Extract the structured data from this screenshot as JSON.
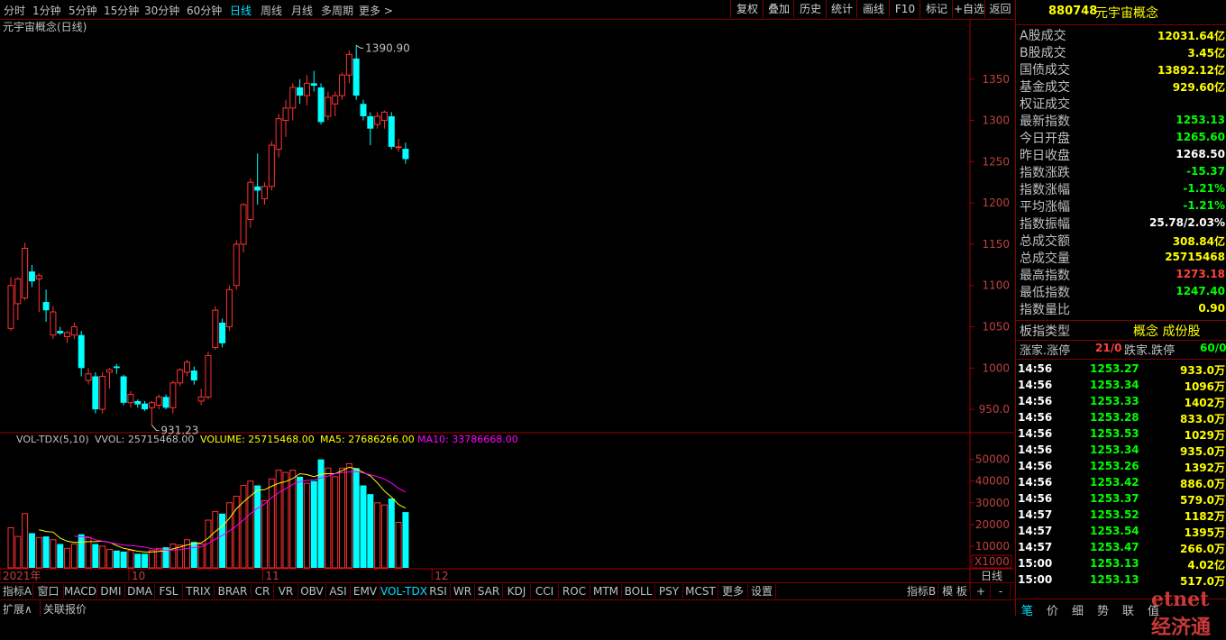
{
  "period_tabs": [
    {
      "label": "分时"
    },
    {
      "label": "1分钟"
    },
    {
      "label": "5分钟"
    },
    {
      "label": "15分钟"
    },
    {
      "label": "30分钟"
    },
    {
      "label": "60分钟"
    },
    {
      "label": "日线"
    },
    {
      "label": "周线"
    },
    {
      "label": "月线"
    },
    {
      "label": "多周期"
    },
    {
      "label": "更多 >"
    }
  ],
  "active_period": "日线",
  "tool_buttons": [
    {
      "label": "复权"
    },
    {
      "label": "叠加"
    },
    {
      "label": "历史"
    },
    {
      "label": "统计"
    },
    {
      "label": "画线"
    },
    {
      "label": "F10"
    },
    {
      "label": "标记"
    },
    {
      "label": "+自选"
    },
    {
      "label": "返回"
    }
  ],
  "chart": {
    "title": "元宇宙概念(日线)",
    "high_label": "1390.90",
    "low_label": "931.23",
    "price_ticks": [
      "1350",
      "1300",
      "1250",
      "1200",
      "1150",
      "1100",
      "1050",
      "1000",
      "950.0"
    ],
    "vol_header": {
      "name": "VOL-TDX(5,10)",
      "vvol": "VVOL: 25715468.00",
      "volume": "VOLUME: 25715468.00",
      "ma5": "MA5: 27686266.00",
      "ma10": "MA10: 33786668.00"
    },
    "vol_ticks": [
      "50000",
      "40000",
      "30000",
      "20000",
      "10000"
    ],
    "vol_unit": "X1000",
    "date_labels": [
      "2021年",
      "10",
      "11",
      "12"
    ],
    "period_label": "日线",
    "colors": {
      "up": "#ff3232",
      "down": "#00ffff",
      "ma5": "#ffff00",
      "ma10": "#ff00ff",
      "axis": "#a00000",
      "grid": "#800000"
    }
  },
  "chart_data": {
    "type": "candlestick",
    "price_range": [
      925,
      1400
    ],
    "volume_range": [
      0,
      54000
    ],
    "candles": [
      {
        "o": 1048,
        "h": 1110,
        "l": 1045,
        "c": 1100,
        "v": 18500
      },
      {
        "o": 1078,
        "h": 1110,
        "l": 1058,
        "c": 1108,
        "v": 14500
      },
      {
        "o": 1085,
        "h": 1152,
        "l": 1082,
        "c": 1145,
        "v": 25000
      },
      {
        "o": 1117,
        "h": 1125,
        "l": 1098,
        "c": 1105,
        "v": 16000
      },
      {
        "o": 1108,
        "h": 1115,
        "l": 1068,
        "c": 1112,
        "v": 14000
      },
      {
        "o": 1080,
        "h": 1095,
        "l": 1056,
        "c": 1070,
        "v": 14500
      },
      {
        "o": 1040,
        "h": 1075,
        "l": 1035,
        "c": 1068,
        "v": 13000
      },
      {
        "o": 1045,
        "h": 1050,
        "l": 1040,
        "c": 1042,
        "v": 11000
      },
      {
        "o": 1038,
        "h": 1045,
        "l": 1030,
        "c": 1043,
        "v": 9000
      },
      {
        "o": 1040,
        "h": 1055,
        "l": 1035,
        "c": 1050,
        "v": 11000
      },
      {
        "o": 1040,
        "h": 1045,
        "l": 990,
        "c": 1000,
        "v": 15500
      },
      {
        "o": 985,
        "h": 1000,
        "l": 980,
        "c": 993,
        "v": 14000
      },
      {
        "o": 990,
        "h": 995,
        "l": 945,
        "c": 950,
        "v": 11000
      },
      {
        "o": 950,
        "h": 995,
        "l": 945,
        "c": 990,
        "v": 10000
      },
      {
        "o": 995,
        "h": 1000,
        "l": 975,
        "c": 998,
        "v": 8500
      },
      {
        "o": 1002,
        "h": 1005,
        "l": 993,
        "c": 1000,
        "v": 8000
      },
      {
        "o": 990,
        "h": 992,
        "l": 955,
        "c": 958,
        "v": 7500
      },
      {
        "o": 958,
        "h": 972,
        "l": 952,
        "c": 968,
        "v": 8000
      },
      {
        "o": 960,
        "h": 962,
        "l": 952,
        "c": 956,
        "v": 6500
      },
      {
        "o": 957,
        "h": 960,
        "l": 948,
        "c": 950,
        "v": 6500
      },
      {
        "o": 952,
        "h": 960,
        "l": 931,
        "c": 958,
        "v": 8000
      },
      {
        "o": 955,
        "h": 968,
        "l": 950,
        "c": 965,
        "v": 9000
      },
      {
        "o": 965,
        "h": 968,
        "l": 950,
        "c": 952,
        "v": 9500
      },
      {
        "o": 952,
        "h": 985,
        "l": 945,
        "c": 982,
        "v": 11000
      },
      {
        "o": 982,
        "h": 1000,
        "l": 978,
        "c": 998,
        "v": 10500
      },
      {
        "o": 995,
        "h": 1010,
        "l": 990,
        "c": 1007,
        "v": 13000
      },
      {
        "o": 997,
        "h": 1002,
        "l": 980,
        "c": 985,
        "v": 12000
      },
      {
        "o": 960,
        "h": 975,
        "l": 955,
        "c": 965,
        "v": 11000
      },
      {
        "o": 965,
        "h": 1020,
        "l": 962,
        "c": 1015,
        "v": 22000
      },
      {
        "o": 1025,
        "h": 1075,
        "l": 1022,
        "c": 1070,
        "v": 26000
      },
      {
        "o": 1055,
        "h": 1060,
        "l": 1025,
        "c": 1030,
        "v": 25000
      },
      {
        "o": 1050,
        "h": 1100,
        "l": 1045,
        "c": 1095,
        "v": 30000
      },
      {
        "o": 1100,
        "h": 1155,
        "l": 1095,
        "c": 1150,
        "v": 33000
      },
      {
        "o": 1150,
        "h": 1200,
        "l": 1140,
        "c": 1198,
        "v": 38000
      },
      {
        "o": 1180,
        "h": 1230,
        "l": 1170,
        "c": 1225,
        "v": 40000
      },
      {
        "o": 1220,
        "h": 1260,
        "l": 1198,
        "c": 1215,
        "v": 38000
      },
      {
        "o": 1205,
        "h": 1225,
        "l": 1198,
        "c": 1220,
        "v": 31000
      },
      {
        "o": 1220,
        "h": 1275,
        "l": 1215,
        "c": 1270,
        "v": 41000
      },
      {
        "o": 1265,
        "h": 1308,
        "l": 1255,
        "c": 1302,
        "v": 45000
      },
      {
        "o": 1300,
        "h": 1325,
        "l": 1280,
        "c": 1315,
        "v": 44000
      },
      {
        "o": 1315,
        "h": 1345,
        "l": 1300,
        "c": 1340,
        "v": 45000
      },
      {
        "o": 1340,
        "h": 1350,
        "l": 1320,
        "c": 1330,
        "v": 42000
      },
      {
        "o": 1330,
        "h": 1355,
        "l": 1318,
        "c": 1345,
        "v": 39000
      },
      {
        "o": 1345,
        "h": 1360,
        "l": 1335,
        "c": 1342,
        "v": 40000
      },
      {
        "o": 1340,
        "h": 1345,
        "l": 1295,
        "c": 1298,
        "v": 50000
      },
      {
        "o": 1305,
        "h": 1335,
        "l": 1300,
        "c": 1328,
        "v": 46000
      },
      {
        "o": 1320,
        "h": 1335,
        "l": 1305,
        "c": 1330,
        "v": 42000
      },
      {
        "o": 1330,
        "h": 1358,
        "l": 1325,
        "c": 1355,
        "v": 46000
      },
      {
        "o": 1355,
        "h": 1385,
        "l": 1345,
        "c": 1380,
        "v": 48000
      },
      {
        "o": 1375,
        "h": 1390.9,
        "l": 1325,
        "c": 1330,
        "v": 46000
      },
      {
        "o": 1320,
        "h": 1325,
        "l": 1300,
        "c": 1305,
        "v": 38000
      },
      {
        "o": 1305,
        "h": 1310,
        "l": 1270,
        "c": 1290,
        "v": 34000
      },
      {
        "o": 1295,
        "h": 1310,
        "l": 1290,
        "c": 1305,
        "v": 30000
      },
      {
        "o": 1300,
        "h": 1312,
        "l": 1290,
        "c": 1310,
        "v": 29000
      },
      {
        "o": 1305,
        "h": 1310,
        "l": 1265,
        "c": 1268,
        "v": 32000
      },
      {
        "o": 1268,
        "h": 1278,
        "l": 1262,
        "c": 1268,
        "v": 21000
      },
      {
        "o": 1265.6,
        "h": 1273.18,
        "l": 1247.4,
        "c": 1253.13,
        "v": 25715
      }
    ],
    "date_ticks": [
      {
        "i": 0,
        "label": "2021年"
      },
      {
        "i": 17,
        "label": "10"
      },
      {
        "i": 36,
        "label": "11"
      },
      {
        "i": 60,
        "label": "12"
      }
    ]
  },
  "panel": {
    "code": "880748",
    "name": "元宇宙概念",
    "stats": [
      {
        "label": "A股成交",
        "value": "12031.64亿",
        "color": "#ffff00"
      },
      {
        "label": "B股成交",
        "value": "3.45亿",
        "color": "#ffff00"
      },
      {
        "label": "国债成交",
        "value": "13892.12亿",
        "color": "#ffff00"
      },
      {
        "label": "基金成交",
        "value": "929.60亿",
        "color": "#ffff00"
      },
      {
        "label": "权证成交",
        "value": "",
        "color": "#ffff00"
      },
      {
        "label": "最新指数",
        "value": "1253.13",
        "color": "#00ff00"
      },
      {
        "label": "今日开盘",
        "value": "1265.60",
        "color": "#00ff00"
      },
      {
        "label": "昨日收盘",
        "value": "1268.50",
        "color": "#ffffff"
      },
      {
        "label": "指数涨跌",
        "value": "-15.37",
        "color": "#00ff00"
      },
      {
        "label": "指数涨幅",
        "value": "-1.21%",
        "color": "#00ff00"
      },
      {
        "label": "平均涨幅",
        "value": "-1.21%",
        "color": "#00ff00"
      },
      {
        "label": "指数振幅",
        "value": "25.78/2.03%",
        "color": "#ffffff"
      },
      {
        "label": "总成交额",
        "value": "308.84亿",
        "color": "#ffff00"
      },
      {
        "label": "总成交量",
        "value": "25715468",
        "color": "#ffff00"
      },
      {
        "label": "最高指数",
        "value": "1273.18",
        "color": "#ff4040"
      },
      {
        "label": "最低指数",
        "value": "1247.40",
        "color": "#00ff00"
      },
      {
        "label": "指数量比",
        "value": "0.90",
        "color": "#ffff00"
      }
    ],
    "type_label": "板指类型",
    "type_value": "概念 成份股",
    "updown": {
      "l1": "涨家.涨停",
      "v1": "21/0",
      "l2": "跌家.跌停",
      "v2": "60/0"
    },
    "ticks": [
      {
        "t": "14:56",
        "p": "1253.27",
        "v": "933.0万"
      },
      {
        "t": "14:56",
        "p": "1253.34",
        "v": "1096万"
      },
      {
        "t": "14:56",
        "p": "1253.33",
        "v": "1402万"
      },
      {
        "t": "14:56",
        "p": "1253.28",
        "v": "833.0万"
      },
      {
        "t": "14:56",
        "p": "1253.53",
        "v": "1029万"
      },
      {
        "t": "14:56",
        "p": "1253.34",
        "v": "935.0万"
      },
      {
        "t": "14:56",
        "p": "1253.26",
        "v": "1392万"
      },
      {
        "t": "14:56",
        "p": "1253.42",
        "v": "886.0万"
      },
      {
        "t": "14:56",
        "p": "1253.37",
        "v": "579.0万"
      },
      {
        "t": "14:57",
        "p": "1253.52",
        "v": "1182万"
      },
      {
        "t": "14:57",
        "p": "1253.54",
        "v": "1395万"
      },
      {
        "t": "14:57",
        "p": "1253.47",
        "v": "266.0万"
      },
      {
        "t": "15:00",
        "p": "1253.13",
        "v": "4.02亿"
      },
      {
        "t": "15:00",
        "p": "1253.13",
        "v": "517.0万"
      }
    ],
    "bottom_tabs": [
      {
        "label": "笔"
      },
      {
        "label": "价"
      },
      {
        "label": "细"
      },
      {
        "label": "势"
      },
      {
        "label": "联"
      },
      {
        "label": "值"
      }
    ]
  },
  "bottom_tabs": [
    {
      "label": "指标A"
    },
    {
      "label": "窗口"
    },
    {
      "label": "MACD"
    },
    {
      "label": "DMI"
    },
    {
      "label": "DMA"
    },
    {
      "label": "FSL"
    },
    {
      "label": "TRIX"
    },
    {
      "label": "BRAR"
    },
    {
      "label": "CR"
    },
    {
      "label": "VR"
    },
    {
      "label": "OBV"
    },
    {
      "label": "ASI"
    },
    {
      "label": "EMV"
    },
    {
      "label": "VOL-TDX"
    },
    {
      "label": "RSI"
    },
    {
      "label": "WR"
    },
    {
      "label": "SAR"
    },
    {
      "label": "KDJ"
    },
    {
      "label": "CCI"
    },
    {
      "label": "ROC"
    },
    {
      "label": "MTM"
    },
    {
      "label": "BOLL"
    },
    {
      "label": "PSY"
    },
    {
      "label": "MCST"
    },
    {
      "label": "更多"
    },
    {
      "label": "设置"
    }
  ],
  "active_bottom_tab": "VOL-TDX",
  "bottom_right": {
    "b1": "指标B",
    "b2": "模 板",
    "b3": "+",
    "b4": "-"
  },
  "status": {
    "expand": "扩展∧",
    "related": "关联报价"
  },
  "watermark": "etnet 经济通"
}
